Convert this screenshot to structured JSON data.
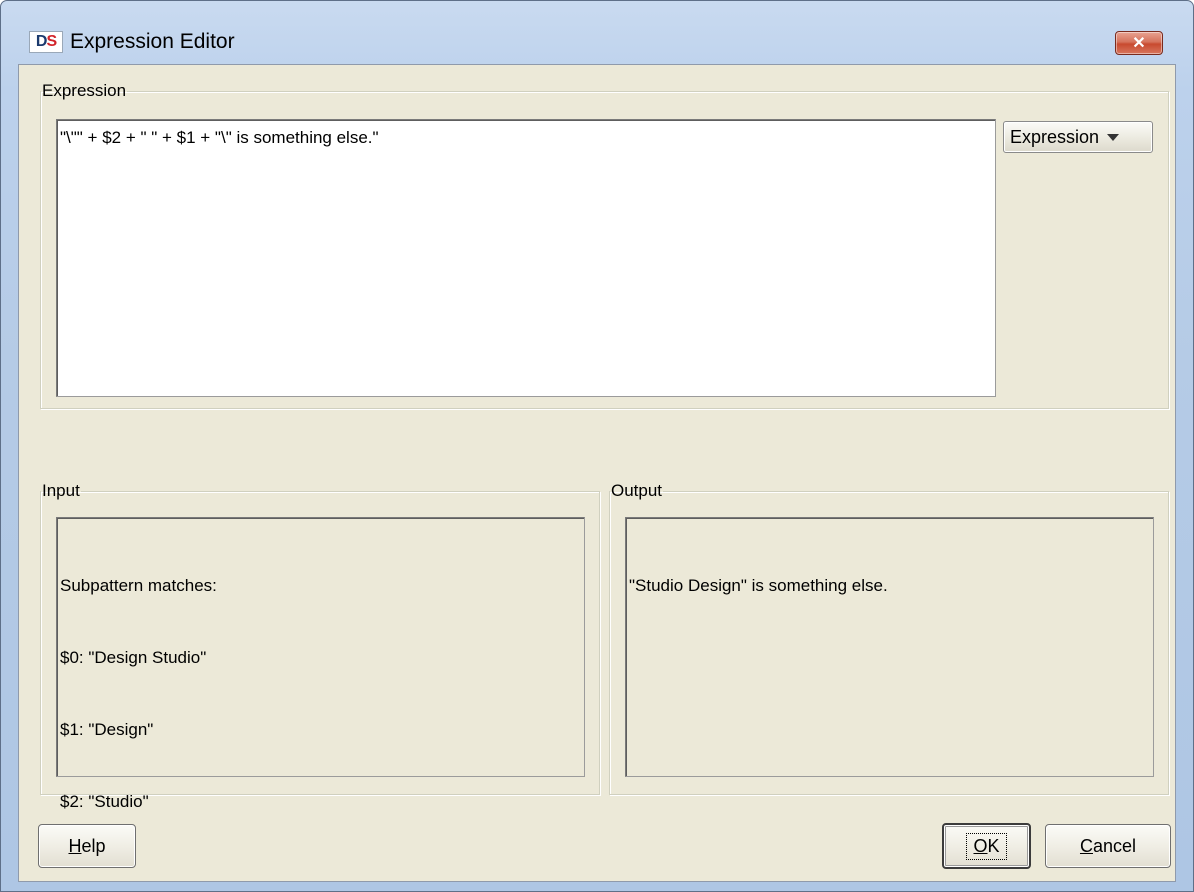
{
  "window": {
    "title": "Expression Editor",
    "logo_text_d": "D",
    "logo_text_s": "S",
    "close_glyph": "✕"
  },
  "expression_group": {
    "legend": "Expression",
    "value": "\"\\\"\" + $2 + \" \" + $1 + \"\\\" is something else.\"",
    "dropdown_label": "Expression"
  },
  "input_group": {
    "legend": "Input",
    "lines": [
      "Subpattern matches:",
      "$0: \"Design Studio\"",
      "$1: \"Design\"",
      "$2: \"Studio\""
    ]
  },
  "output_group": {
    "legend": "Output",
    "lines": [
      "\"Studio Design\" is something else."
    ]
  },
  "buttons": {
    "help_mnemonic": "H",
    "help_rest": "elp",
    "ok_mnemonic": "O",
    "ok_rest": "K",
    "cancel_mnemonic": "C",
    "cancel_rest": "ancel"
  },
  "icons": {
    "app": "ds-logo-icon",
    "close": "close-icon",
    "dropdown": "chevron-down-icon"
  }
}
